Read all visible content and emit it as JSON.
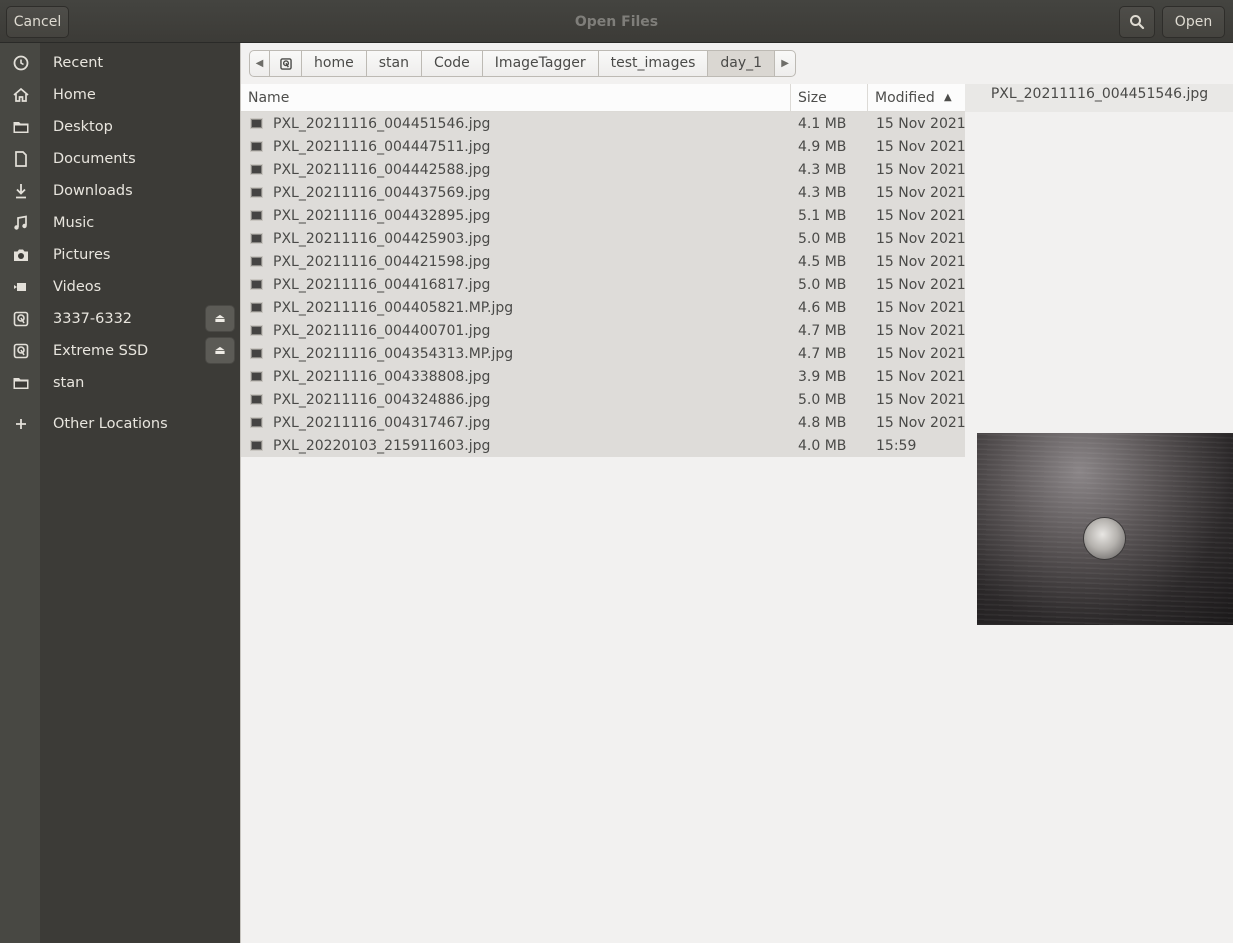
{
  "window": {
    "title": "Open Files"
  },
  "header": {
    "cancel_label": "Cancel",
    "open_label": "Open",
    "search_icon": "search-icon"
  },
  "sidebar": {
    "items": [
      {
        "label": "Recent",
        "icon": "clock-icon"
      },
      {
        "label": "Home",
        "icon": "home-icon"
      },
      {
        "label": "Desktop",
        "icon": "folder-icon"
      },
      {
        "label": "Documents",
        "icon": "document-icon"
      },
      {
        "label": "Downloads",
        "icon": "download-icon"
      },
      {
        "label": "Music",
        "icon": "music-icon"
      },
      {
        "label": "Pictures",
        "icon": "camera-icon"
      },
      {
        "label": "Videos",
        "icon": "video-icon"
      },
      {
        "label": "3337-6332",
        "icon": "drive-icon",
        "eject": true
      },
      {
        "label": "Extreme SSD",
        "icon": "drive-icon",
        "eject": true
      },
      {
        "label": "stan",
        "icon": "folder-icon"
      },
      {
        "label": "Other Locations",
        "icon": "plus-icon"
      }
    ]
  },
  "pathbar": {
    "segments": [
      "home",
      "stan",
      "Code",
      "ImageTagger",
      "test_images",
      "day_1"
    ],
    "active": "day_1"
  },
  "columns": {
    "name": "Name",
    "size": "Size",
    "modified": "Modified"
  },
  "files": [
    {
      "name": "PXL_20211116_004451546.jpg",
      "size": "4.1 MB",
      "modified": "15 Nov 2021"
    },
    {
      "name": "PXL_20211116_004447511.jpg",
      "size": "4.9 MB",
      "modified": "15 Nov 2021"
    },
    {
      "name": "PXL_20211116_004442588.jpg",
      "size": "4.3 MB",
      "modified": "15 Nov 2021"
    },
    {
      "name": "PXL_20211116_004437569.jpg",
      "size": "4.3 MB",
      "modified": "15 Nov 2021"
    },
    {
      "name": "PXL_20211116_004432895.jpg",
      "size": "5.1 MB",
      "modified": "15 Nov 2021"
    },
    {
      "name": "PXL_20211116_004425903.jpg",
      "size": "5.0 MB",
      "modified": "15 Nov 2021"
    },
    {
      "name": "PXL_20211116_004421598.jpg",
      "size": "4.5 MB",
      "modified": "15 Nov 2021"
    },
    {
      "name": "PXL_20211116_004416817.jpg",
      "size": "5.0 MB",
      "modified": "15 Nov 2021"
    },
    {
      "name": "PXL_20211116_004405821.MP.jpg",
      "size": "4.6 MB",
      "modified": "15 Nov 2021"
    },
    {
      "name": "PXL_20211116_004400701.jpg",
      "size": "4.7 MB",
      "modified": "15 Nov 2021"
    },
    {
      "name": "PXL_20211116_004354313.MP.jpg",
      "size": "4.7 MB",
      "modified": "15 Nov 2021"
    },
    {
      "name": "PXL_20211116_004338808.jpg",
      "size": "3.9 MB",
      "modified": "15 Nov 2021"
    },
    {
      "name": "PXL_20211116_004324886.jpg",
      "size": "5.0 MB",
      "modified": "15 Nov 2021"
    },
    {
      "name": "PXL_20211116_004317467.jpg",
      "size": "4.8 MB",
      "modified": "15 Nov 2021"
    },
    {
      "name": "PXL_20220103_215911603.jpg",
      "size": "4.0 MB",
      "modified": "15:59"
    }
  ],
  "preview": {
    "filename": "PXL_20211116_004451546.jpg"
  }
}
